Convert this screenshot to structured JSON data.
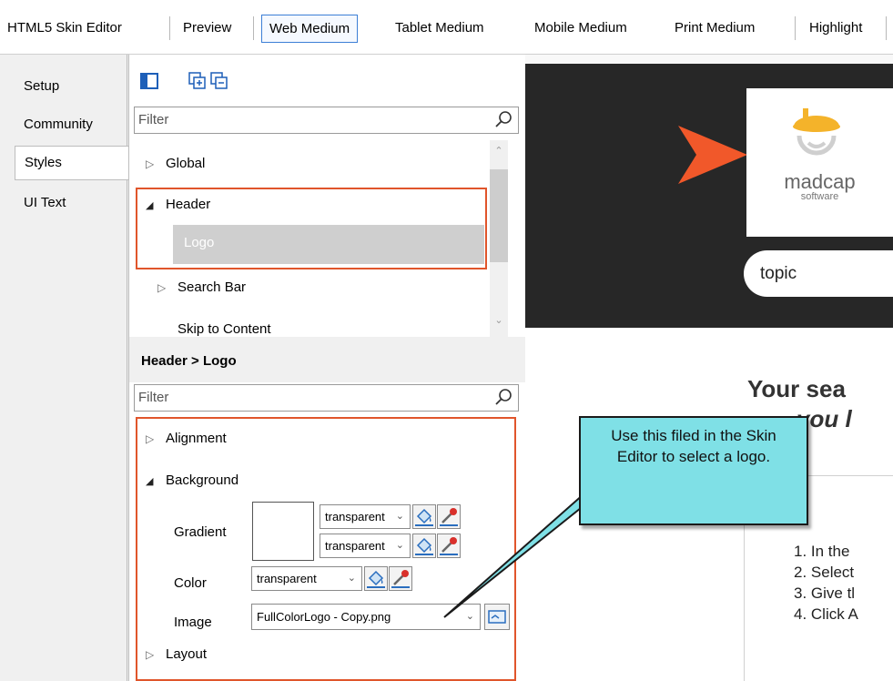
{
  "top_tabs": [
    "HTML5 Skin Editor",
    "Preview",
    "Web Medium",
    "Tablet Medium",
    "Mobile Medium",
    "Print Medium",
    "Highlight"
  ],
  "active_top_tab": "Web Medium",
  "side_tabs": [
    "Setup",
    "Community",
    "Styles",
    "UI Text"
  ],
  "active_side_tab": "Styles",
  "tree_filter": {
    "placeholder": "Filter"
  },
  "tree_items": {
    "global": "Global",
    "header": "Header",
    "logo": "Logo",
    "search_bar": "Search Bar",
    "skip_to_content": "Skip to Content"
  },
  "breadcrumb": "Header > Logo",
  "prop_filter": {
    "placeholder": "Filter"
  },
  "properties": {
    "alignment": "Alignment",
    "background": "Background",
    "gradient": "Gradient",
    "gradient_start": "transparent",
    "gradient_end": "transparent",
    "color": "Color",
    "color_value": "transparent",
    "image": "Image",
    "image_value": "FullColorLogo - Copy.png",
    "layout": "Layout"
  },
  "preview": {
    "brand": "madcap",
    "brand_sub": "software",
    "search_text": "topic",
    "title_line1": "Your sea",
    "title_line2": "you l",
    "steps": [
      "1. In the",
      "2. Select",
      "3. Give tl",
      "4. Click A"
    ]
  },
  "callout": {
    "text": "Use this filed in the Skin Editor to select a logo."
  },
  "colors": {
    "highlight_border": "#e0552b",
    "callout_fill": "#7fe0e6",
    "selected_row": "#cfcfcf",
    "active_tab_border": "#3c7fd6"
  }
}
